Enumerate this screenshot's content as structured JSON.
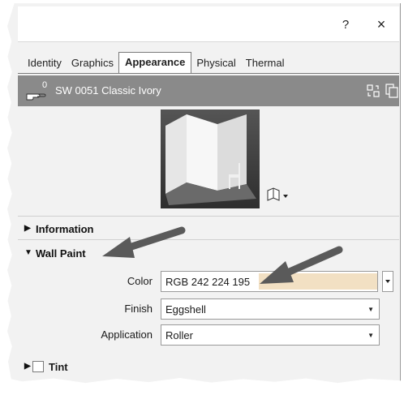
{
  "dialog": {
    "help_label": "?",
    "close_label": "×"
  },
  "tabs": [
    {
      "label": "Identity"
    },
    {
      "label": "Graphics"
    },
    {
      "label": "Appearance",
      "active": true
    },
    {
      "label": "Physical"
    },
    {
      "label": "Thermal"
    }
  ],
  "asset": {
    "user_count": "0",
    "name": "SW 0051 Classic Ivory"
  },
  "sections": {
    "information": {
      "label": "Information",
      "expanded": false
    },
    "wall_paint": {
      "label": "Wall Paint",
      "expanded": true
    },
    "tint": {
      "label": "Tint",
      "expanded": false,
      "checked": false
    }
  },
  "properties": {
    "color": {
      "label": "Color",
      "value": "RGB 242 224 195",
      "swatch": "#f2e0c3"
    },
    "finish": {
      "label": "Finish",
      "value": "Eggshell"
    },
    "application": {
      "label": "Application",
      "value": "Roller"
    }
  },
  "colors": {
    "asset_bar": "#8a8a8a",
    "panel_bg": "#f2f2f2",
    "arrow": "#5a5a5a"
  },
  "icons": [
    "hand-pointer-icon",
    "replace-asset-icon",
    "duplicate-asset-icon",
    "preview-scene-icon",
    "triangle-right-icon",
    "triangle-down-icon",
    "dropdown-caret-icon"
  ]
}
